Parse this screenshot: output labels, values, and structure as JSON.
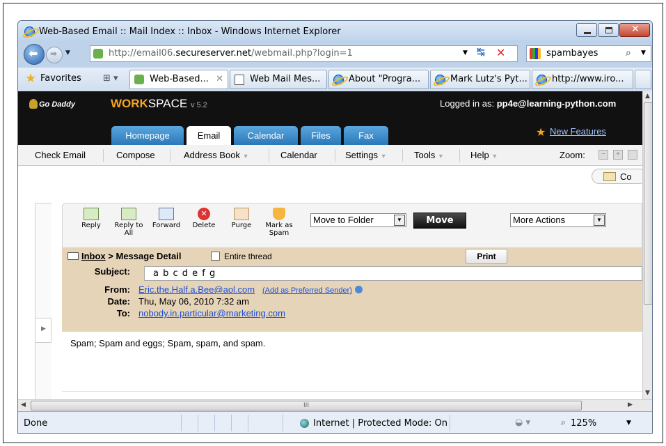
{
  "window": {
    "title": "Web-Based Email :: Mail Index :: Inbox - Windows Internet Explorer"
  },
  "address": {
    "url_prefix": "http://email06.",
    "url_domain": "secureserver.net",
    "url_suffix": "/webmail.php?login=1"
  },
  "search": {
    "value": "spambayes"
  },
  "favorites": {
    "label": "Favorites"
  },
  "tabs": [
    {
      "label": "Web-Based..."
    },
    {
      "label": "Web Mail Mes..."
    },
    {
      "label": "About \"Progra..."
    },
    {
      "label": "Mark Lutz's Pyt..."
    },
    {
      "label": "http://www.iro..."
    }
  ],
  "workspace": {
    "brand": "Go Daddy",
    "name_bold": "WORK",
    "name_light": "SPACE",
    "version": "v 5.2",
    "logged_in_label": "Logged in as:",
    "logged_in_user": "pp4e@learning-python.com",
    "new_features": "New Features"
  },
  "app_tabs": [
    {
      "label": "Homepage"
    },
    {
      "label": "Email"
    },
    {
      "label": "Calendar"
    },
    {
      "label": "Files"
    },
    {
      "label": "Fax"
    }
  ],
  "menu": {
    "check_email": "Check Email",
    "compose": "Compose",
    "address_book": "Address Book",
    "calendar": "Calendar",
    "settings": "Settings",
    "tools": "Tools",
    "help": "Help",
    "zoom": "Zoom:",
    "co": "Co"
  },
  "toolbar": {
    "reply": "Reply",
    "reply_all_1": "Reply to",
    "reply_all_2": "All",
    "forward": "Forward",
    "delete": "Delete",
    "purge": "Purge",
    "spam_1": "Mark as",
    "spam_2": "Spam",
    "move_to_folder": "Move to Folder",
    "move": "Move",
    "more_actions": "More Actions"
  },
  "message": {
    "breadcrumb_inbox": "Inbox",
    "breadcrumb_rest": "> Message Detail",
    "entire_thread": "Entire thread",
    "print": "Print",
    "subject_label": "Subject:",
    "subject": "a b c d e f g",
    "from_label": "From:",
    "from": "Eric.the.Half.a.Bee@aol.com",
    "add_preferred": "(Add as Preferred Sender)",
    "date_label": "Date:",
    "date": "Thu, May 06, 2010 7:32 am",
    "to_label": "To:",
    "to": "nobody.in.particular@marketing.com",
    "body": "Spam; Spam and eggs; Spam, spam, and spam."
  },
  "hscroll": {
    "grip": "III"
  },
  "status": {
    "done": "Done",
    "zone": "Internet | Protected Mode: On",
    "zoom": "125%"
  }
}
